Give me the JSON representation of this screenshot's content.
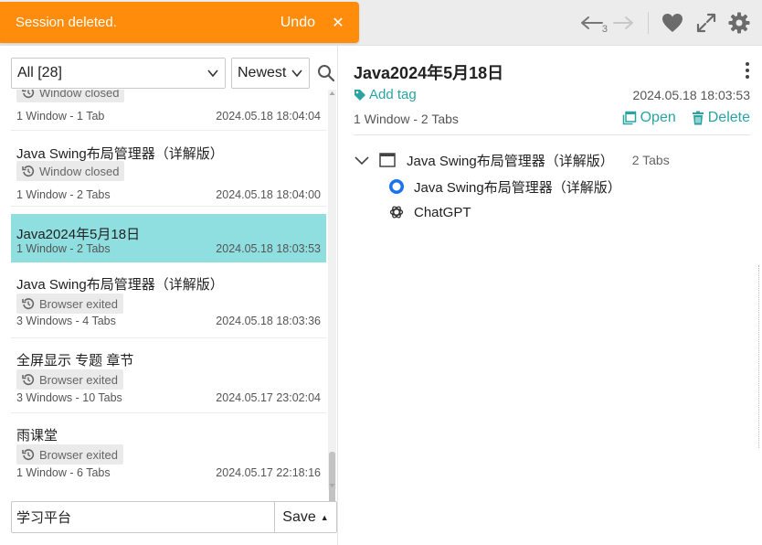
{
  "toast": {
    "message": "Session deleted.",
    "undo_label": "Undo",
    "close_glyph": "✕",
    "color": "#ff8c0a"
  },
  "toolbar": {
    "history_count": "3",
    "icons": [
      "back-arrow-icon",
      "forward-arrow-icon",
      "heart-icon",
      "expand-icon",
      "gear-icon"
    ]
  },
  "filters": {
    "all_label": "All [28]",
    "sort_label": "Newest"
  },
  "sessions": [
    {
      "title": "",
      "badge": "Window closed",
      "meta_left": "1 Window - 1 Tab",
      "meta_right": "2024.05.18 18:04:04"
    },
    {
      "title": "Java Swing布局管理器（详解版）",
      "badge": "Window closed",
      "meta_left": "1 Window - 2 Tabs",
      "meta_right": "2024.05.18 18:04:00"
    },
    {
      "title": "Java2024年5月18日",
      "badge": "",
      "meta_left": "1 Window - 2 Tabs",
      "meta_right": "2024.05.18 18:03:53",
      "active": true
    },
    {
      "title": "Java Swing布局管理器（详解版）",
      "badge": "Browser exited",
      "meta_left": "3 Windows - 4 Tabs",
      "meta_right": "2024.05.18 18:03:36"
    },
    {
      "title": "全屏显示 专题 章节",
      "badge": "Browser exited",
      "meta_left": "3 Windows - 10 Tabs",
      "meta_right": "2024.05.17 23:02:04"
    },
    {
      "title": "雨课堂",
      "badge": "Browser exited",
      "meta_left": "1 Window - 6 Tabs",
      "meta_right": "2024.05.17 22:18:16"
    }
  ],
  "save": {
    "input_value": "学习平台",
    "button_label": "Save"
  },
  "detail": {
    "title": "Java2024年5月18日",
    "add_tag_label": "Add tag",
    "date": "2024.05.18 18:03:53",
    "count": "1 Window - 2 Tabs",
    "open_label": "Open",
    "delete_label": "Delete",
    "window_title": "Java Swing布局管理器（详解版）",
    "window_tabs": "2 Tabs",
    "tabs": [
      {
        "title": "Java Swing布局管理器（详解版）",
        "icon": "blue-circle-icon"
      },
      {
        "title": "ChatGPT",
        "icon": "chatgpt-icon"
      }
    ]
  },
  "colors": {
    "accent": "#2aa3a3",
    "active_row": "#8fdfe0",
    "toast": "#ff8c0a"
  }
}
